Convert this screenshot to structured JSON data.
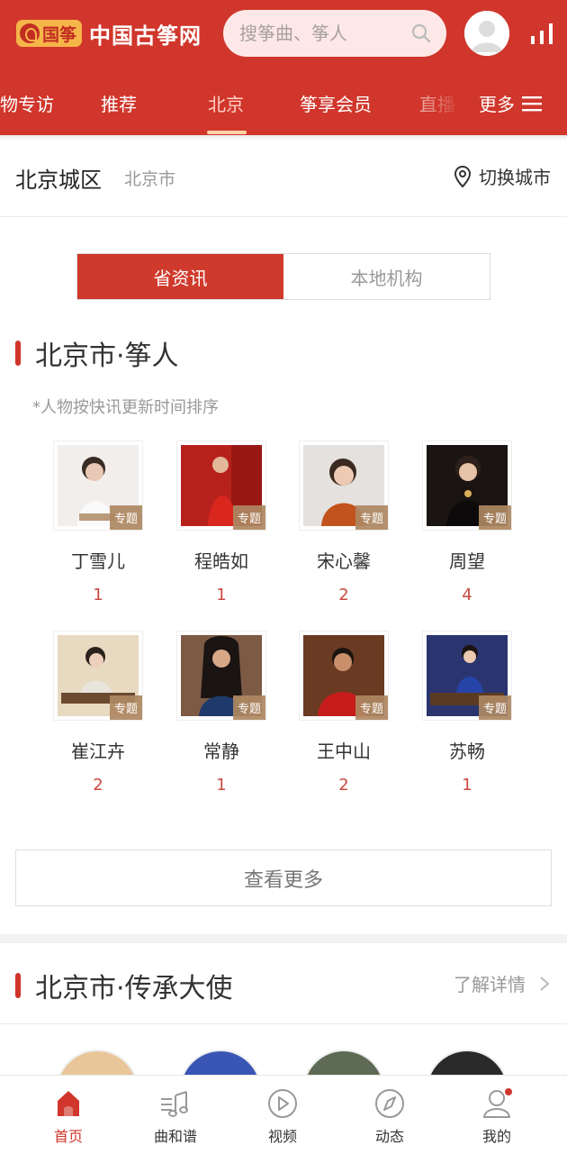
{
  "header": {
    "logo_badge": "国筝",
    "logo_text": "中国古筝网",
    "search_placeholder": "搜筝曲、筝人",
    "nav": [
      "物专访",
      "推荐",
      "北京",
      "筝享会员",
      "直播"
    ],
    "nav_active": "北京",
    "nav_more": "更多"
  },
  "city": {
    "title": "北京城区",
    "sub": "北京市",
    "switch_label": "切换城市"
  },
  "segment": {
    "left": "省资讯",
    "right": "本地机构"
  },
  "people_section": {
    "title": "北京市·筝人",
    "note": "*人物按快讯更新时间排序",
    "badge": "专题",
    "people": [
      {
        "name": "丁雪儿",
        "count": "1"
      },
      {
        "name": "程皓如",
        "count": "1"
      },
      {
        "name": "宋心馨",
        "count": "2"
      },
      {
        "name": "周望",
        "count": "4"
      },
      {
        "name": "崔江卉",
        "count": "2"
      },
      {
        "name": "常静",
        "count": "1"
      },
      {
        "name": "王中山",
        "count": "2"
      },
      {
        "name": "苏畅",
        "count": "1"
      }
    ],
    "more_button": "查看更多"
  },
  "ambassador_section": {
    "title": "北京市·传承大使",
    "detail": "了解详情"
  },
  "tabbar": [
    {
      "label": "首页",
      "icon": "home-icon"
    },
    {
      "label": "曲和谱",
      "icon": "music-score-icon"
    },
    {
      "label": "视频",
      "icon": "video-play-icon"
    },
    {
      "label": "动态",
      "icon": "compass-icon"
    },
    {
      "label": "我的",
      "icon": "user-icon"
    }
  ],
  "colors": {
    "brand": "#d0362b",
    "badge": "#ae8862",
    "count": "#c84a40"
  }
}
